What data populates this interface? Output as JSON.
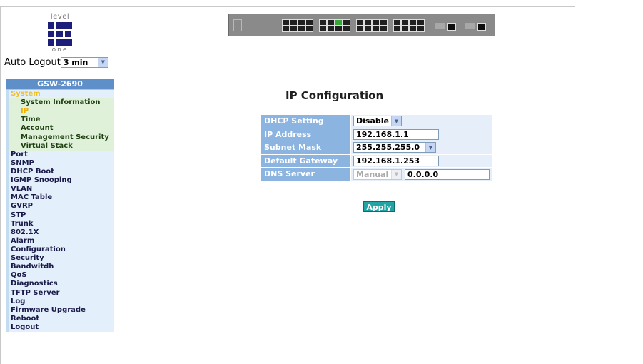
{
  "logo": {
    "brand": "level",
    "sub": "one"
  },
  "auto_logout": {
    "label": "Auto Logout",
    "value": "3 min"
  },
  "sidebar": {
    "header": "GSW-2690",
    "items": [
      {
        "label": "System",
        "type": "group-active"
      },
      {
        "label": "System Information",
        "type": "sub"
      },
      {
        "label": "IP",
        "type": "sub-current"
      },
      {
        "label": "Time",
        "type": "sub"
      },
      {
        "label": "Account",
        "type": "sub"
      },
      {
        "label": "Management Security",
        "type": "sub"
      },
      {
        "label": "Virtual Stack",
        "type": "sub"
      },
      {
        "label": "Port",
        "type": "item"
      },
      {
        "label": "SNMP",
        "type": "item"
      },
      {
        "label": "DHCP Boot",
        "type": "item"
      },
      {
        "label": "IGMP Snooping",
        "type": "item"
      },
      {
        "label": "VLAN",
        "type": "item"
      },
      {
        "label": "MAC Table",
        "type": "item"
      },
      {
        "label": "GVRP",
        "type": "item"
      },
      {
        "label": "STP",
        "type": "item"
      },
      {
        "label": "Trunk",
        "type": "item"
      },
      {
        "label": "802.1X",
        "type": "item"
      },
      {
        "label": "Alarm",
        "type": "item"
      },
      {
        "label": "Configuration",
        "type": "item"
      },
      {
        "label": "Security",
        "type": "item"
      },
      {
        "label": "Bandwitdh",
        "type": "item"
      },
      {
        "label": "QoS",
        "type": "item"
      },
      {
        "label": "Diagnostics",
        "type": "item"
      },
      {
        "label": "TFTP Server",
        "type": "item"
      },
      {
        "label": "Log",
        "type": "item"
      },
      {
        "label": "Firmware Upgrade",
        "type": "item"
      },
      {
        "label": "Reboot",
        "type": "item"
      },
      {
        "label": "Logout",
        "type": "item"
      }
    ]
  },
  "main": {
    "title": "IP Configuration",
    "fields": {
      "dhcp": {
        "label": "DHCP Setting",
        "value": "Disable"
      },
      "ip": {
        "label": "IP Address",
        "value": "192.168.1.1"
      },
      "mask": {
        "label": "Subnet Mask",
        "value": "255.255.255.0"
      },
      "gateway": {
        "label": "Default Gateway",
        "value": "192.168.1.253"
      },
      "dns": {
        "label": "DNS Server",
        "mode": "Manual",
        "value": "0.0.0.0"
      }
    },
    "apply_label": "Apply"
  },
  "colors": {
    "sidebar_header": "#5f8fc9",
    "label_cell": "#8bb4e0",
    "apply_button": "#22a4a4",
    "active_text": "#f0c020"
  }
}
